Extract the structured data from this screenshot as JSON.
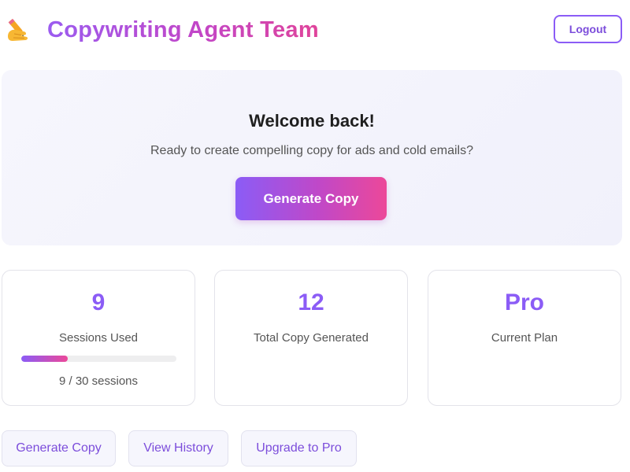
{
  "header": {
    "icon": "writing-hand-icon",
    "title": "Copywriting Agent Team",
    "logout_label": "Logout"
  },
  "welcome": {
    "title": "Welcome back!",
    "subtitle": "Ready to create compelling copy for ads and cold emails?",
    "cta_label": "Generate Copy"
  },
  "stats": [
    {
      "value": "9",
      "label": "Sessions Used",
      "progress": {
        "used": 9,
        "total": 30,
        "fraction": 0.3,
        "text": "9 / 30 sessions"
      }
    },
    {
      "value": "12",
      "label": "Total Copy Generated"
    },
    {
      "value": "Pro",
      "label": "Current Plan"
    }
  ],
  "actions": [
    {
      "label": "Generate Copy"
    },
    {
      "label": "View History"
    },
    {
      "label": "Upgrade to Pro"
    }
  ],
  "colors": {
    "accent_purple": "#8b5cf6",
    "accent_pink": "#ec4899",
    "panel_bg": "#f6f6fd"
  }
}
